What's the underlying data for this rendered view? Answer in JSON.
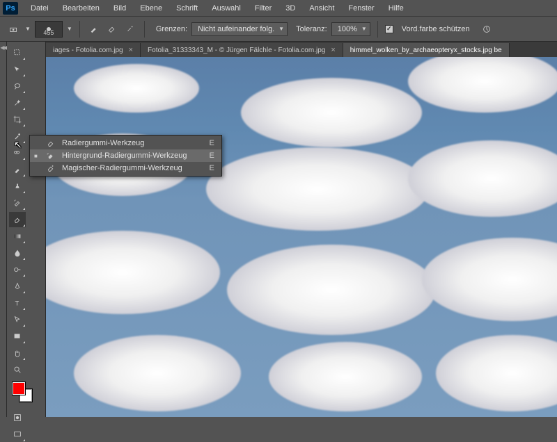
{
  "app": {
    "logo": "Ps"
  },
  "menus": [
    "Datei",
    "Bearbeiten",
    "Bild",
    "Ebene",
    "Schrift",
    "Auswahl",
    "Filter",
    "3D",
    "Ansicht",
    "Fenster",
    "Hilfe"
  ],
  "options": {
    "brush_size": "455",
    "limits_label": "Grenzen:",
    "limits_value": "Nicht aufeinander folg.",
    "tolerance_label": "Toleranz:",
    "tolerance_value": "100%",
    "protect_label": "Vord.farbe schützen"
  },
  "tabs": [
    {
      "label": "iages - Fotolia.com.jpg",
      "active": false
    },
    {
      "label": "Fotolia_31333343_M - © Jürgen Fälchle - Fotolia.com.jpg",
      "active": false
    },
    {
      "label": "himmel_wolken_by_archaeopteryx_stocks.jpg be",
      "active": true
    }
  ],
  "flyout": {
    "items": [
      {
        "label": "Radiergummi-Werkzeug",
        "key": "E",
        "selected": false
      },
      {
        "label": "Hintergrund-Radiergummi-Werkzeug",
        "key": "E",
        "selected": true
      },
      {
        "label": "Magischer-Radiergummi-Werkzeug",
        "key": "E",
        "selected": false
      }
    ]
  },
  "colors": {
    "fg": "#ff0000",
    "bg": "#ffffff"
  }
}
